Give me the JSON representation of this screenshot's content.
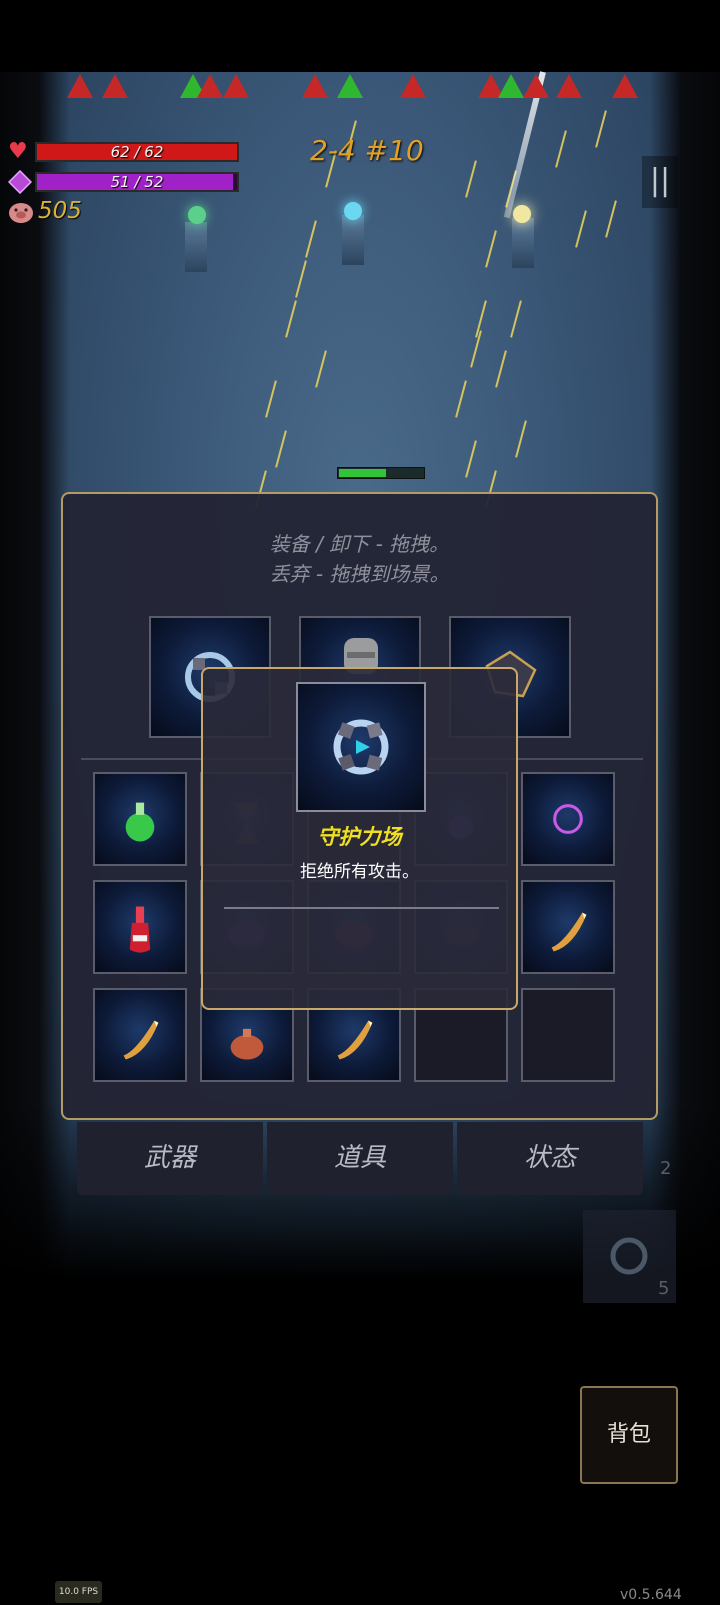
{
  "hud": {
    "hp_text": "62 / 62",
    "hp_fraction": 1.0,
    "mp_text": "51 / 52",
    "mp_fraction": 0.98,
    "coins": "505",
    "stage": "2-4 #10",
    "pause_icon": "pause-icon"
  },
  "enemy_wave_markers": [
    "red",
    "red",
    "green",
    "red",
    "red",
    "red",
    "green",
    "red",
    "red",
    "green",
    "red",
    "red",
    "red"
  ],
  "enemy_health_fraction": 0.55,
  "inventory": {
    "hint_line1": "装备 / 卸下 - 拖拽。",
    "hint_line2": "丢弃 - 拖拽到场景。",
    "equipped_slots": [
      "shield-orb-icon",
      "stone-helmet-icon",
      "gold-crystal-icon"
    ],
    "item_slots": [
      "green-potion-icon",
      "hourglass-icon",
      "",
      "purple-potion-icon",
      "dark-vortex-icon",
      "red-potion-icon",
      "purple-jar-icon",
      "red-jar-icon",
      "dark-pot-icon",
      "horn-icon",
      "horn-icon",
      "clay-pot-icon",
      "horn-icon",
      "",
      ""
    ]
  },
  "tooltip": {
    "title": "守护力场",
    "description": "拒绝所有攻击。",
    "icon": "shield-orb-icon"
  },
  "tabs": {
    "weapons": "武器",
    "items": "道具",
    "status": "状态"
  },
  "side_count": "2",
  "quick_slot_count": "5",
  "bag_button": "背包",
  "fps": "10.0 FPS",
  "version": "v0.5.644"
}
